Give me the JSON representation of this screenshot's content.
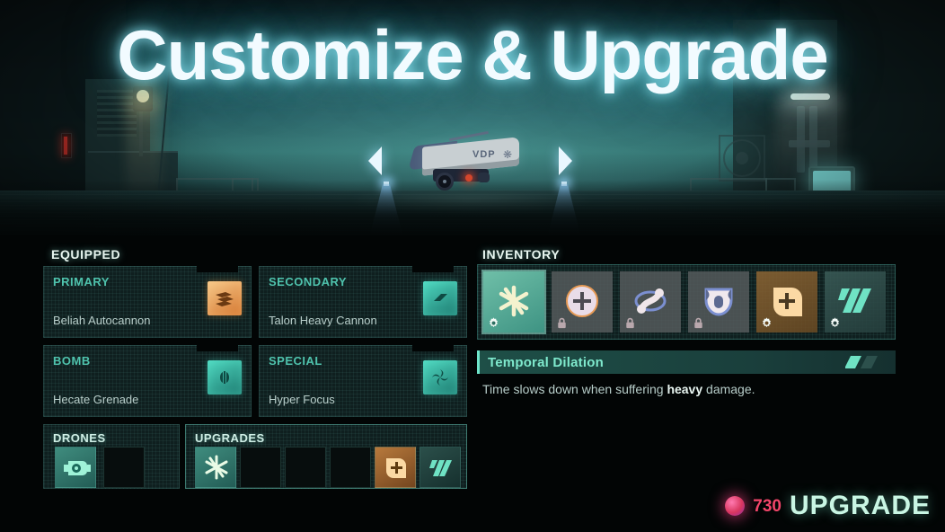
{
  "title": "Customize & Upgrade",
  "ship": {
    "decal": "VDP"
  },
  "nav": {
    "prev_icon": "chevron-left-icon",
    "next_icon": "chevron-right-icon"
  },
  "equipped": {
    "label": "EQUIPPED",
    "slots": [
      {
        "type": "PRIMARY",
        "name": "Beliah Autocannon",
        "icon": "autocannon-icon",
        "tint": "orange"
      },
      {
        "type": "SECONDARY",
        "name": "Talon Heavy Cannon",
        "icon": "cannon-icon",
        "tint": "teal"
      },
      {
        "type": "BOMB",
        "name": "Hecate Grenade",
        "icon": "grenade-icon",
        "tint": "teal"
      },
      {
        "type": "SPECIAL",
        "name": "Hyper Focus",
        "icon": "spiral-icon",
        "tint": "teal"
      }
    ]
  },
  "drones": {
    "label": "DRONES",
    "cells": [
      {
        "icon": "drone-icon",
        "state": "filled"
      },
      {
        "icon": "",
        "state": "empty"
      }
    ]
  },
  "upgrades": {
    "label": "UPGRADES",
    "cells": [
      {
        "icon": "starburst-icon",
        "state": "filled"
      },
      {
        "icon": "",
        "state": "empty"
      },
      {
        "icon": "",
        "state": "empty"
      },
      {
        "icon": "",
        "state": "empty"
      },
      {
        "icon": "plus-square-icon",
        "state": "filled-orange"
      },
      {
        "icon": "slashes-icon",
        "state": "filled-dark"
      }
    ]
  },
  "inventory": {
    "label": "INVENTORY",
    "items": [
      {
        "icon": "starburst-icon",
        "badge": "gear-icon",
        "state": "selected"
      },
      {
        "icon": "plus-circle-icon",
        "badge": "lock-icon",
        "state": "locked"
      },
      {
        "icon": "double-helix-icon",
        "badge": "lock-icon",
        "state": "locked"
      },
      {
        "icon": "shield-core-icon",
        "badge": "lock-icon",
        "state": "locked"
      },
      {
        "icon": "plus-square-icon",
        "badge": "gear-icon",
        "state": "owned"
      },
      {
        "icon": "slashes-icon",
        "badge": "gear-icon",
        "state": "owned"
      }
    ]
  },
  "detail": {
    "name": "Temporal Dilation",
    "icon": "slashes-icon",
    "description_before": "Time slows down when suffering ",
    "description_emphasis": "heavy",
    "description_after": " damage."
  },
  "footer": {
    "currency_amount": "730",
    "currency_icon": "orb-icon",
    "action_label": "UPGRADE"
  },
  "colors": {
    "accent_teal": "#4fd8c0",
    "accent_orange": "#e89a4a",
    "title_glow": "#8cf0ff",
    "currency": "#f2456a"
  }
}
